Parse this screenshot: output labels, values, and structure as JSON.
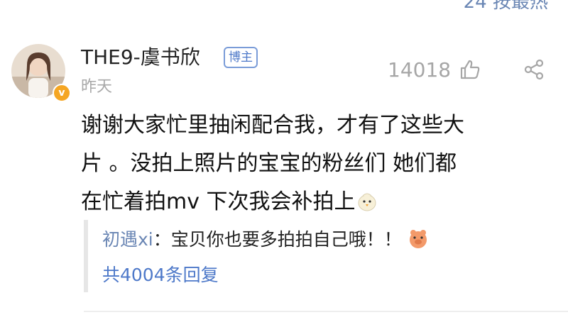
{
  "header_partial": {
    "text": "24 按最热"
  },
  "comment": {
    "username": "THE9-虞书欣",
    "role_badge": "博主",
    "time": "昨天",
    "like_count": "14018",
    "text_lines": [
      "谢谢大家忙里抽闲配合我，才有了这些大",
      "片 。没拍上照片的宝宝的粉丝们 她们都",
      "在忙着拍mv 下次我会补拍上"
    ],
    "reply": {
      "user": "初遇xi",
      "separator": "：",
      "text": "宝贝你也要多拍拍自己哦！！",
      "total": "共4004条回复"
    }
  },
  "icons": {
    "verified": "verified-v-icon",
    "like": "thumbs-up-icon",
    "share": "share-icon",
    "content_emoji": "chick-emoji-icon",
    "reply_emoji": "pig-emoji-icon"
  },
  "colors": {
    "link_blue": "#4e79c9",
    "username_blue": "#6a86b4",
    "gray": "#a8a8a8",
    "badge_border": "#7a9cd8",
    "verified_orange": "#f5a623"
  }
}
